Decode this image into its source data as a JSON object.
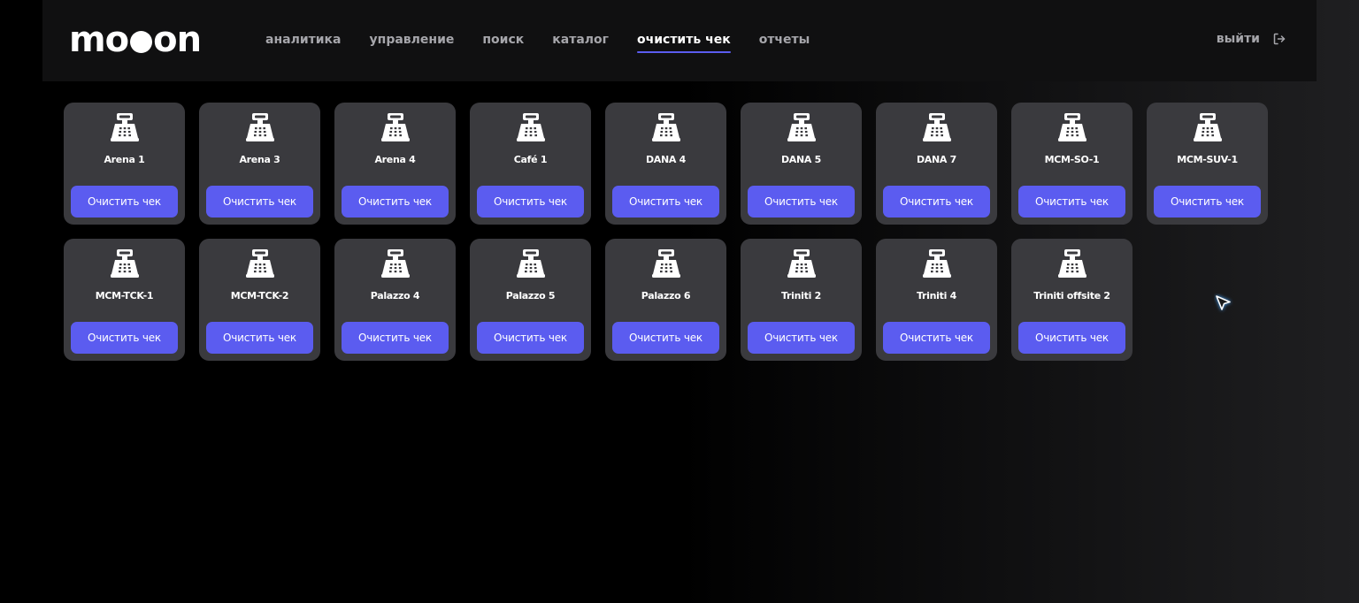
{
  "header": {
    "logo_text": "mooon",
    "nav": [
      {
        "label": "аналитика",
        "active": false
      },
      {
        "label": "управление",
        "active": false
      },
      {
        "label": "поиск",
        "active": false
      },
      {
        "label": "каталог",
        "active": false
      },
      {
        "label": "очистить чек",
        "active": true
      },
      {
        "label": "отчеты",
        "active": false
      }
    ],
    "logout_label": "выйти",
    "logout_icon": "logout-icon"
  },
  "registers": [
    {
      "name": "Arena 1",
      "button": "Очистить чек"
    },
    {
      "name": "Arena 3",
      "button": "Очистить чек"
    },
    {
      "name": "Arena 4",
      "button": "Очистить чек"
    },
    {
      "name": "Café 1",
      "button": "Очистить чек"
    },
    {
      "name": "DANA 4",
      "button": "Очистить чек"
    },
    {
      "name": "DANA 5",
      "button": "Очистить чек"
    },
    {
      "name": "DANA 7",
      "button": "Очистить чек"
    },
    {
      "name": "MCM-SO-1",
      "button": "Очистить чек"
    },
    {
      "name": "MCM-SUV-1",
      "button": "Очистить чек"
    },
    {
      "name": "MCM-TCK-1",
      "button": "Очистить чек"
    },
    {
      "name": "MCM-TCK-2",
      "button": "Очистить чек"
    },
    {
      "name": "Palazzo 4",
      "button": "Очистить чек"
    },
    {
      "name": "Palazzo 5",
      "button": "Очистить чек"
    },
    {
      "name": "Palazzo 6",
      "button": "Очистить чек"
    },
    {
      "name": "Triniti 2",
      "button": "Очистить чек"
    },
    {
      "name": "Triniti 4",
      "button": "Очистить чек"
    },
    {
      "name": "Triniti offsite 2",
      "button": "Очистить чек"
    }
  ],
  "register_icon": "cash-register-icon",
  "colors": {
    "accent": "#5b5cf0",
    "card": "#3a3a3e",
    "header": "#101011",
    "nav_inactive": "#a6a6ab"
  }
}
